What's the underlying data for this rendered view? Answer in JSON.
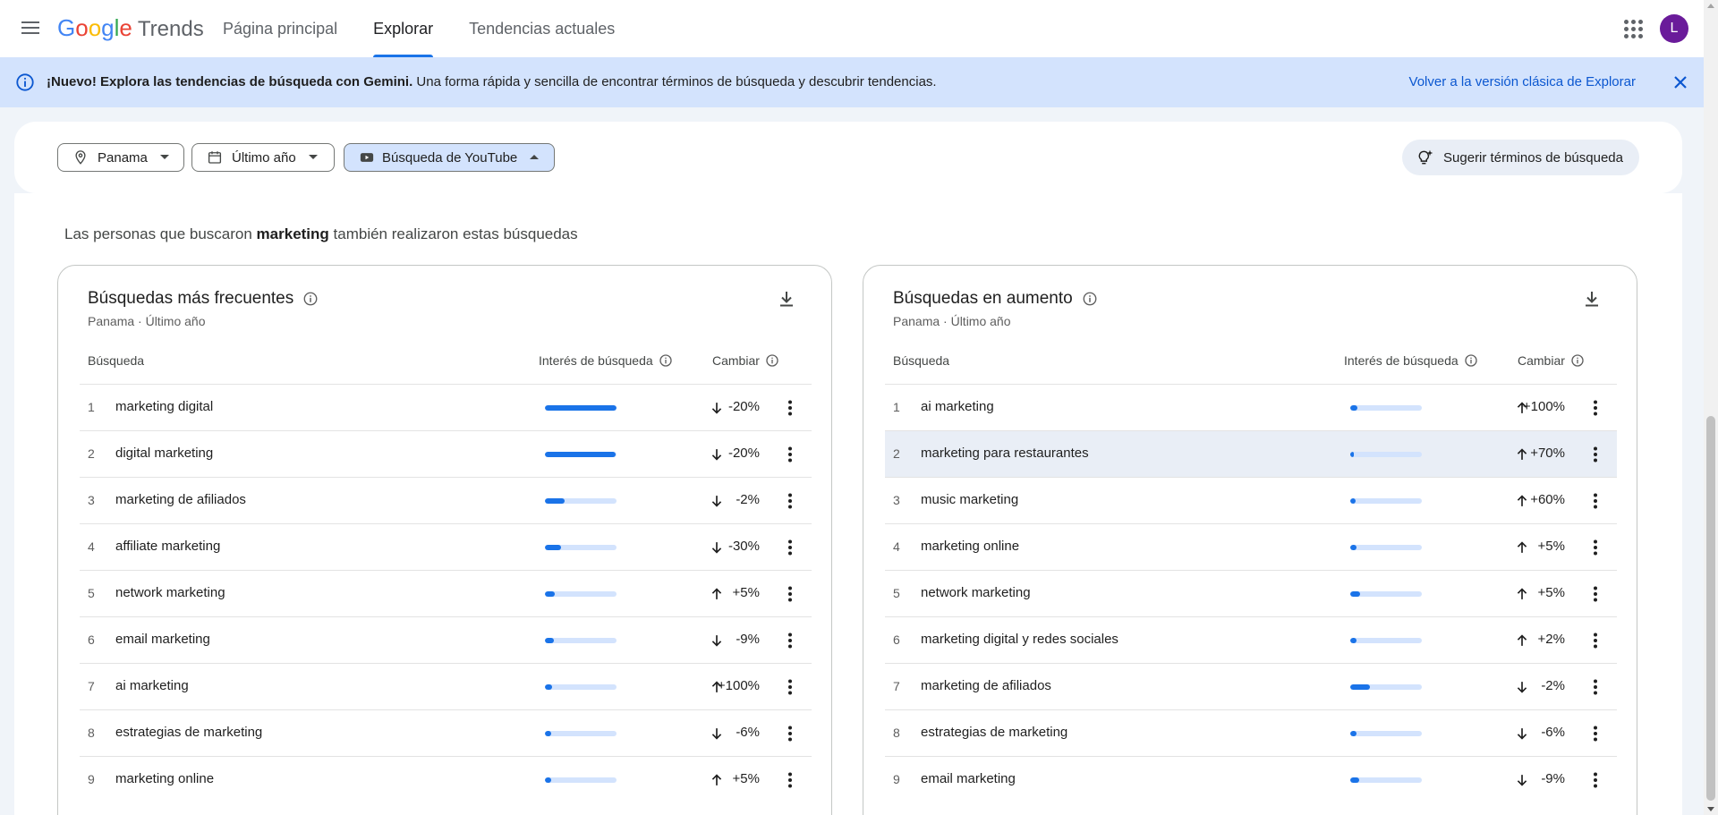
{
  "header": {
    "logo_google": [
      "G",
      "o",
      "o",
      "g",
      "l",
      "e"
    ],
    "logo_trends": "Trends",
    "nav": [
      {
        "label": "Página principal",
        "active": false
      },
      {
        "label": "Explorar",
        "active": true
      },
      {
        "label": "Tendencias actuales",
        "active": false
      }
    ],
    "avatar_initial": "L"
  },
  "banner": {
    "bold": "¡Nuevo! Explora las tendencias de búsqueda con Gemini.",
    "text": " Una forma rápida y sencilla de encontrar términos de búsqueda y descubrir tendencias.",
    "classic_link": "Volver a la versión clásica de Explorar"
  },
  "filters": {
    "location": "Panama",
    "time": "Último año",
    "source": "Búsqueda de YouTube",
    "suggest": "Sugerir términos de búsqueda"
  },
  "related": {
    "prefix": "Las personas que buscaron ",
    "term": "marketing",
    "suffix": " también realizaron estas búsquedas"
  },
  "columns": {
    "search": "Búsqueda",
    "interest": "Interés de búsqueda",
    "change": "Cambiar"
  },
  "top_card": {
    "title": "Búsquedas más frecuentes",
    "subtitle": "Panama · Último año",
    "rows": [
      {
        "n": "1",
        "term": "marketing digital",
        "interest": 1.0,
        "dir": "down",
        "change": "-20%"
      },
      {
        "n": "2",
        "term": "digital marketing",
        "interest": 0.99,
        "dir": "down",
        "change": "-20%"
      },
      {
        "n": "3",
        "term": "marketing de afiliados",
        "interest": 0.27,
        "dir": "down",
        "change": "-2%"
      },
      {
        "n": "4",
        "term": "affiliate marketing",
        "interest": 0.23,
        "dir": "down",
        "change": "-30%"
      },
      {
        "n": "5",
        "term": "network marketing",
        "interest": 0.14,
        "dir": "up",
        "change": "+5%"
      },
      {
        "n": "6",
        "term": "email marketing",
        "interest": 0.12,
        "dir": "down",
        "change": "-9%"
      },
      {
        "n": "7",
        "term": "ai marketing",
        "interest": 0.1,
        "dir": "up",
        "change": "+100%"
      },
      {
        "n": "8",
        "term": "estrategias de marketing",
        "interest": 0.09,
        "dir": "down",
        "change": "-6%"
      },
      {
        "n": "9",
        "term": "marketing online",
        "interest": 0.09,
        "dir": "up",
        "change": "+5%"
      }
    ]
  },
  "rising_card": {
    "title": "Búsquedas en aumento",
    "subtitle": "Panama · Último año",
    "rows": [
      {
        "n": "1",
        "term": "ai marketing",
        "interest": 0.1,
        "dir": "up",
        "change": "+100%"
      },
      {
        "n": "2",
        "term": "marketing para restaurantes",
        "interest": 0.05,
        "dir": "up",
        "change": "+70%"
      },
      {
        "n": "3",
        "term": "music marketing",
        "interest": 0.07,
        "dir": "up",
        "change": "+60%"
      },
      {
        "n": "4",
        "term": "marketing online",
        "interest": 0.09,
        "dir": "up",
        "change": "+5%"
      },
      {
        "n": "5",
        "term": "network marketing",
        "interest": 0.14,
        "dir": "up",
        "change": "+5%"
      },
      {
        "n": "6",
        "term": "marketing digital y redes sociales",
        "interest": 0.09,
        "dir": "up",
        "change": "+2%"
      },
      {
        "n": "7",
        "term": "marketing de afiliados",
        "interest": 0.27,
        "dir": "down",
        "change": "-2%"
      },
      {
        "n": "8",
        "term": "estrategias de marketing",
        "interest": 0.09,
        "dir": "down",
        "change": "-6%"
      },
      {
        "n": "9",
        "term": "email marketing",
        "interest": 0.12,
        "dir": "down",
        "change": "-9%"
      }
    ]
  },
  "colors": {
    "accent": "#1a73e8",
    "banner": "#d3e3fd",
    "bar_track": "#d3e3fd"
  }
}
